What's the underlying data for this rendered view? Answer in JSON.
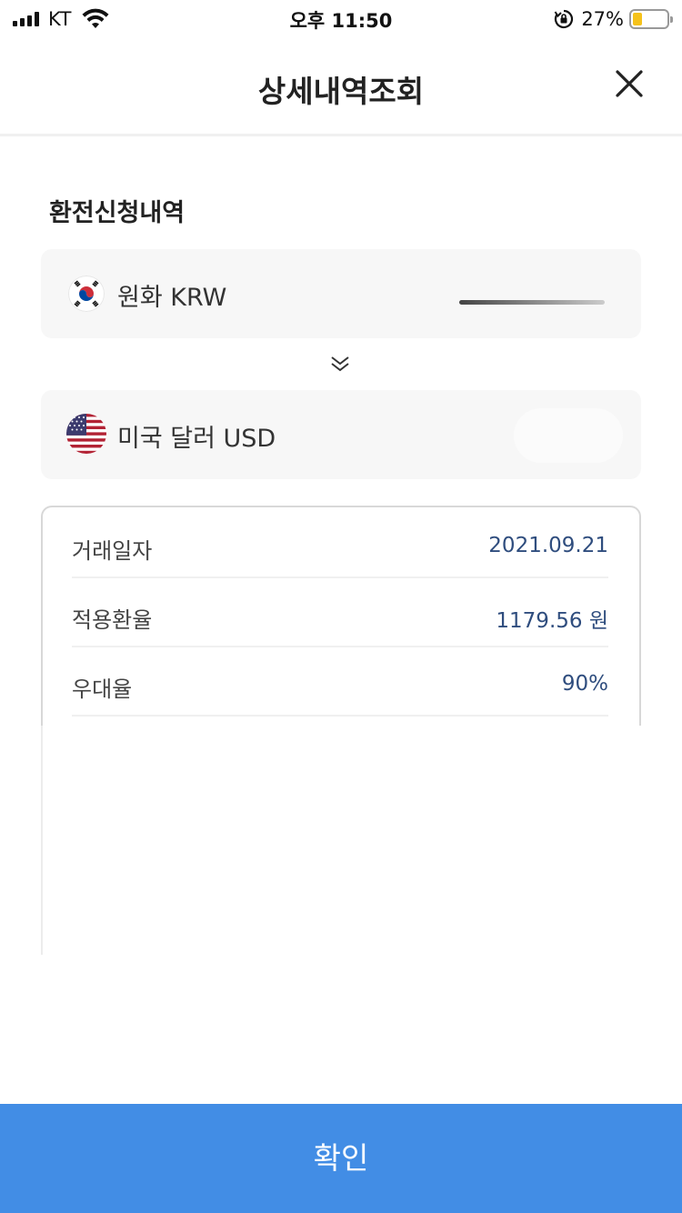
{
  "status_bar": {
    "carrier": "KT",
    "time": "오후 11:50",
    "battery_percent": "27%",
    "battery_level": 0.27,
    "battery_color": "#f5c21b"
  },
  "header": {
    "title": "상세내역조회",
    "close_icon": "close-icon"
  },
  "section": {
    "title": "환전신청내역"
  },
  "from_currency": {
    "name": "원화 KRW",
    "flag_icon": "korea-flag-icon"
  },
  "to_currency": {
    "name": "미국 달러 USD",
    "flag_icon": "us-flag-icon"
  },
  "details": [
    {
      "label": "거래일자",
      "value": "2021.09.21"
    },
    {
      "label": "적용환율",
      "value": "1179.56 원"
    },
    {
      "label": "우대율",
      "value": "90%"
    }
  ],
  "confirm_button": {
    "label": "확인",
    "color": "#428de5"
  },
  "colors": {
    "value_text": "#2f4d7e",
    "card_background": "#f7f7f7"
  }
}
